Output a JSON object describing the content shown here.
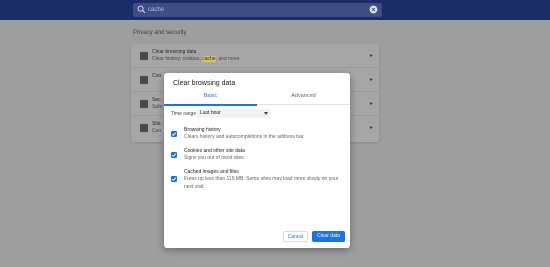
{
  "search": {
    "value": "cache"
  },
  "settings": {
    "section_title": "Privacy and security",
    "rows": [
      {
        "title": "Clear browsing data",
        "sub_before": "Clear history, cookies, ",
        "sub_highlight": "cache",
        "sub_after": ", and more"
      },
      {
        "title": "Coo",
        "sub": ""
      },
      {
        "title": "Sec",
        "sub": "Safe"
      },
      {
        "title": "Site",
        "sub": "Con"
      }
    ]
  },
  "dialog": {
    "title": "Clear browsing data",
    "tabs": [
      {
        "label": "Basic"
      },
      {
        "label": "Advanced"
      }
    ],
    "time_range_label": "Time range",
    "time_range_value": "Last hour",
    "options": [
      {
        "title": "Browsing history",
        "desc": "Clears history and autocompletions in the address bar.",
        "checked": true
      },
      {
        "title": "Cookies and other site data",
        "desc": "Signs you out of most sites.",
        "checked": true
      },
      {
        "title": "Cached images and files",
        "desc": "Frees up less than 119 MB. Some sites may load more slowly on your next visit.",
        "checked": true
      }
    ],
    "cancel_label": "Cancel",
    "clear_label": "Clear data"
  },
  "colors": {
    "accent": "#1a73e8",
    "header": "#1b2b63",
    "overlay": "#9e9e9e"
  }
}
